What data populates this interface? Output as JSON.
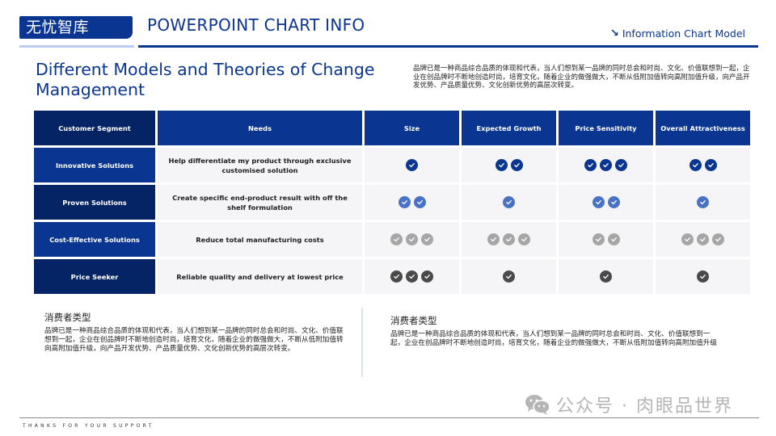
{
  "header": {
    "brand": "无忧智库",
    "title": "POWERPOINT CHART INFO",
    "link_icon": "arrow-down-right-icon",
    "link_label": "Information Chart Model"
  },
  "page": {
    "title": "Different Models and Theories of Change Management",
    "intro": "品牌已是一种商品综合品质的体现和代表，当人们想到某一品牌的同时总会和时尚、文化、价值联想到一起，企业在创品牌时不断地创造时尚，培育文化，随着企业的做强做大，不断从低附加值转向高附加值升级，向产品开发优势、产品质量优势、文化创新优势的高层次转变。"
  },
  "colors": {
    "brand": "#0a3590",
    "navy": "#052466",
    "row_bg": "#f5f4f6",
    "check_dark_blue": "#0a3590",
    "check_light_blue": "#4a72c4",
    "check_light_gray": "#a6a6a6",
    "check_dark_gray": "#4a4a4a"
  },
  "table": {
    "headers": [
      "Customer Segment",
      "Needs",
      "Size",
      "Expected Growth",
      "Price Sensitivity",
      "Overall Attractiveness"
    ],
    "rows": [
      {
        "segment": "Innovative Solutions",
        "needs": "Help differentiate my product through exclusive customised solution",
        "check_color": "#0a3590",
        "ratings": {
          "size": 1,
          "expected_growth": 2,
          "price_sensitivity": 3,
          "overall_attractiveness": 2
        }
      },
      {
        "segment": "Proven Solutions",
        "needs": "Create specific end-product result with off the shelf formulation",
        "check_color": "#4a72c4",
        "ratings": {
          "size": 2,
          "expected_growth": 1,
          "price_sensitivity": 2,
          "overall_attractiveness": 1
        }
      },
      {
        "segment": "Cost-Effective Solutions",
        "needs": "Reduce total manufacturing costs",
        "check_color": "#a6a6a6",
        "ratings": {
          "size": 3,
          "expected_growth": 3,
          "price_sensitivity": 2,
          "overall_attractiveness": 3
        }
      },
      {
        "segment": "Price Seeker",
        "needs": "Reliable quality and delivery at lowest price",
        "check_color": "#4a4a4a",
        "ratings": {
          "size": 3,
          "expected_growth": 1,
          "price_sensitivity": 1,
          "overall_attractiveness": 1
        }
      }
    ]
  },
  "panels": [
    {
      "title": "消费者类型",
      "body": "品牌已是一种商品综合品质的体现和代表，当人们想到某一品牌的同时总会和时尚、文化、价值联想到一起，企业在创品牌时不断地创造时尚，培育文化，随着企业的做强做大，不断从低附加值转向高附加值升级，向产品开发优势、产品质量优势、文化创新优势的高层次转变。"
    },
    {
      "title": "消费者类型",
      "body": "品牌已是一种商品综合品质的体现和代表，当人们想到某一品牌的同时总会和时尚、文化、价值联想到一起，企业在创品牌时不断地创造时尚，培育文化，随着企业的做强做大，不断从低附加值转向高附加值升级"
    }
  ],
  "footer": {
    "text": "THANKS FOR YOUR SUPPORT",
    "watermark_icon": "wechat-icon",
    "watermark": "公众号 · 肉眼品世界"
  }
}
